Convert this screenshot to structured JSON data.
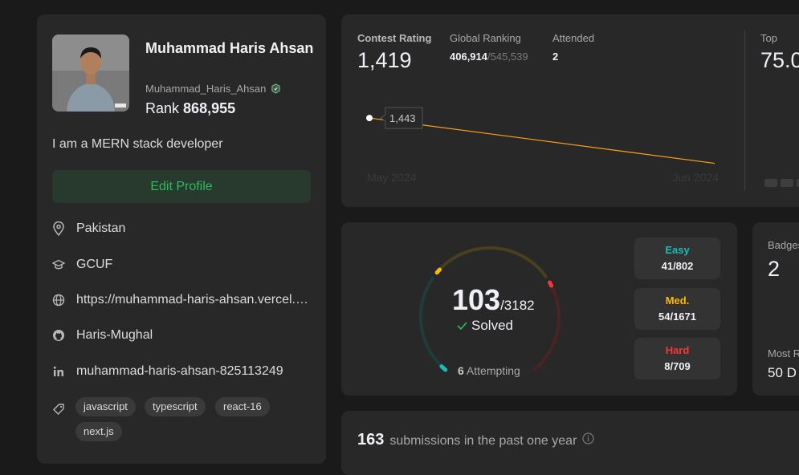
{
  "profile": {
    "name": "Muhammad Haris Ahsan",
    "username": "Muhammad_Haris_Ahsan",
    "rank_label": "Rank",
    "rank_value": "868,955",
    "bio": "I am a MERN stack developer",
    "edit_label": "Edit Profile",
    "location": "Pakistan",
    "school": "GCUF",
    "website": "https://muhammad-haris-ahsan.vercel.app",
    "github": "Haris-Mughal",
    "linkedin": "muhammad-haris-ahsan-825113249",
    "skills": [
      "javascript",
      "typescript",
      "react-16",
      "next.js"
    ]
  },
  "contest": {
    "rating_label": "Contest Rating",
    "rating_value": "1,419",
    "global_label": "Global Ranking",
    "global_rank": "406,914",
    "global_total": "/545,539",
    "attended_label": "Attended",
    "attended_value": "2",
    "top_label": "Top",
    "top_value": "75.0",
    "tooltip_value": "1,443",
    "x_start": "May 2024",
    "x_end": "Jun 2024"
  },
  "chart_data": {
    "type": "line",
    "x": [
      "May 2024",
      "Jun 2024"
    ],
    "series": [
      {
        "values": [
          1443,
          1419
        ]
      }
    ],
    "annotations": [
      "1,443"
    ]
  },
  "solved": {
    "count": "103",
    "total": "/3182",
    "solved_label": "Solved",
    "attempting_count": "6",
    "attempting_label": "Attempting",
    "easy_label": "Easy",
    "easy_value": "41/802",
    "medium_label": "Med.",
    "medium_value": "54/1671",
    "hard_label": "Hard",
    "hard_value": "8/709",
    "colors": {
      "easy": "#1cbaba",
      "medium": "#ffb700",
      "hard": "#f63737"
    }
  },
  "badges": {
    "label": "Badges",
    "count": "2",
    "most_label": "Most R",
    "most_value": "50 D"
  },
  "submissions": {
    "count": "163",
    "text": "submissions in the past one year"
  }
}
